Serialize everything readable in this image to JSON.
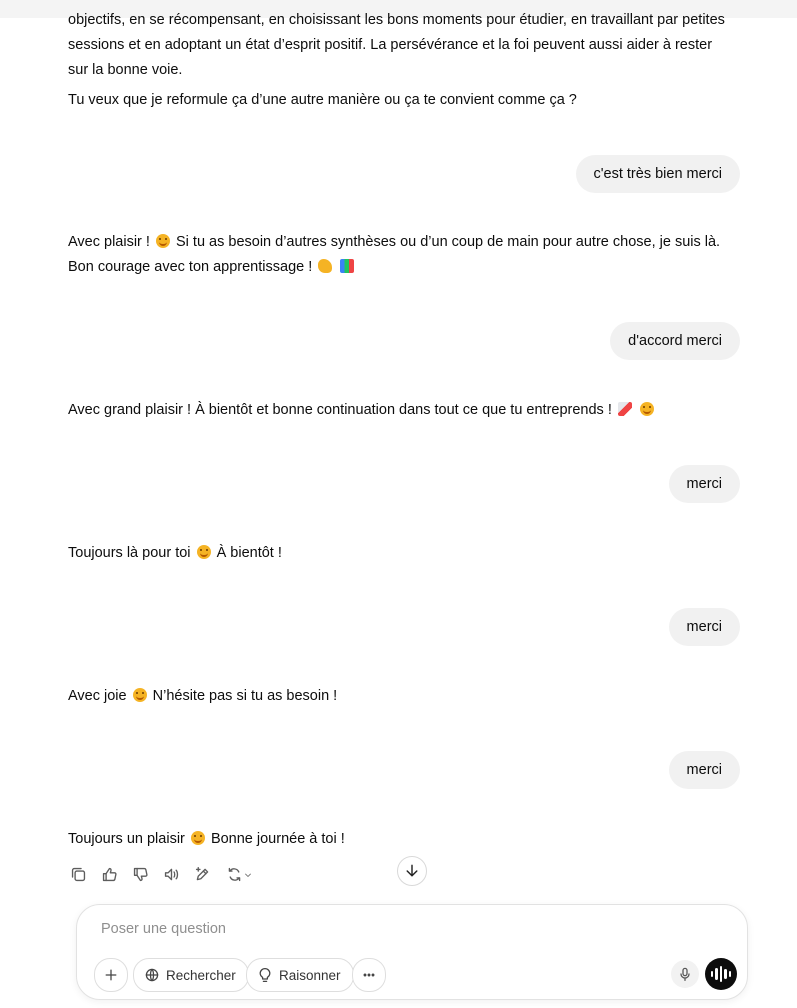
{
  "conversation": {
    "intro_paragraph": "objectifs, en se récompensant, en choisissant les bons moments pour étudier, en travaillant par petites sessions et en adoptant un état d’esprit positif. La persévérance et la foi peuvent aussi aider à rester sur la bonne voie.",
    "intro_question": "Tu veux que je reformule ça d’une autre manière ou ça te convient comme ça ?",
    "user_1": "c'est très bien merci",
    "assistant_1_a": "Avec plaisir !",
    "assistant_1_b": "Si tu as besoin d’autres synthèses ou d’un coup de main pour autre chose, je suis là. Bon courage avec ton apprentissage !",
    "user_2": "d'accord merci",
    "assistant_2": "Avec grand plaisir ! À bientôt et bonne continuation dans tout ce que tu entreprends !",
    "user_3": "merci",
    "assistant_3_a": "Toujours là pour toi",
    "assistant_3_b": "À bientôt !",
    "user_4": "merci",
    "assistant_4_a": "Avec joie",
    "assistant_4_b": "N’hésite pas si tu as besoin !",
    "user_5": "merci",
    "assistant_5_a": "Toujours un plaisir",
    "assistant_5_b": "Bonne journée à toi !"
  },
  "message_actions": {
    "icons": [
      "copy-icon",
      "thumbs-up-icon",
      "thumbs-down-icon",
      "read-aloud-icon",
      "edit-icon",
      "regenerate-icon"
    ]
  },
  "composer": {
    "placeholder": "Poser une question",
    "search_label": "Rechercher",
    "reason_label": "Raisonner"
  },
  "colors": {
    "user_bubble": "#f1f1f1",
    "voice_button": "#0d0d0d",
    "placeholder": "#8f8f8f"
  }
}
